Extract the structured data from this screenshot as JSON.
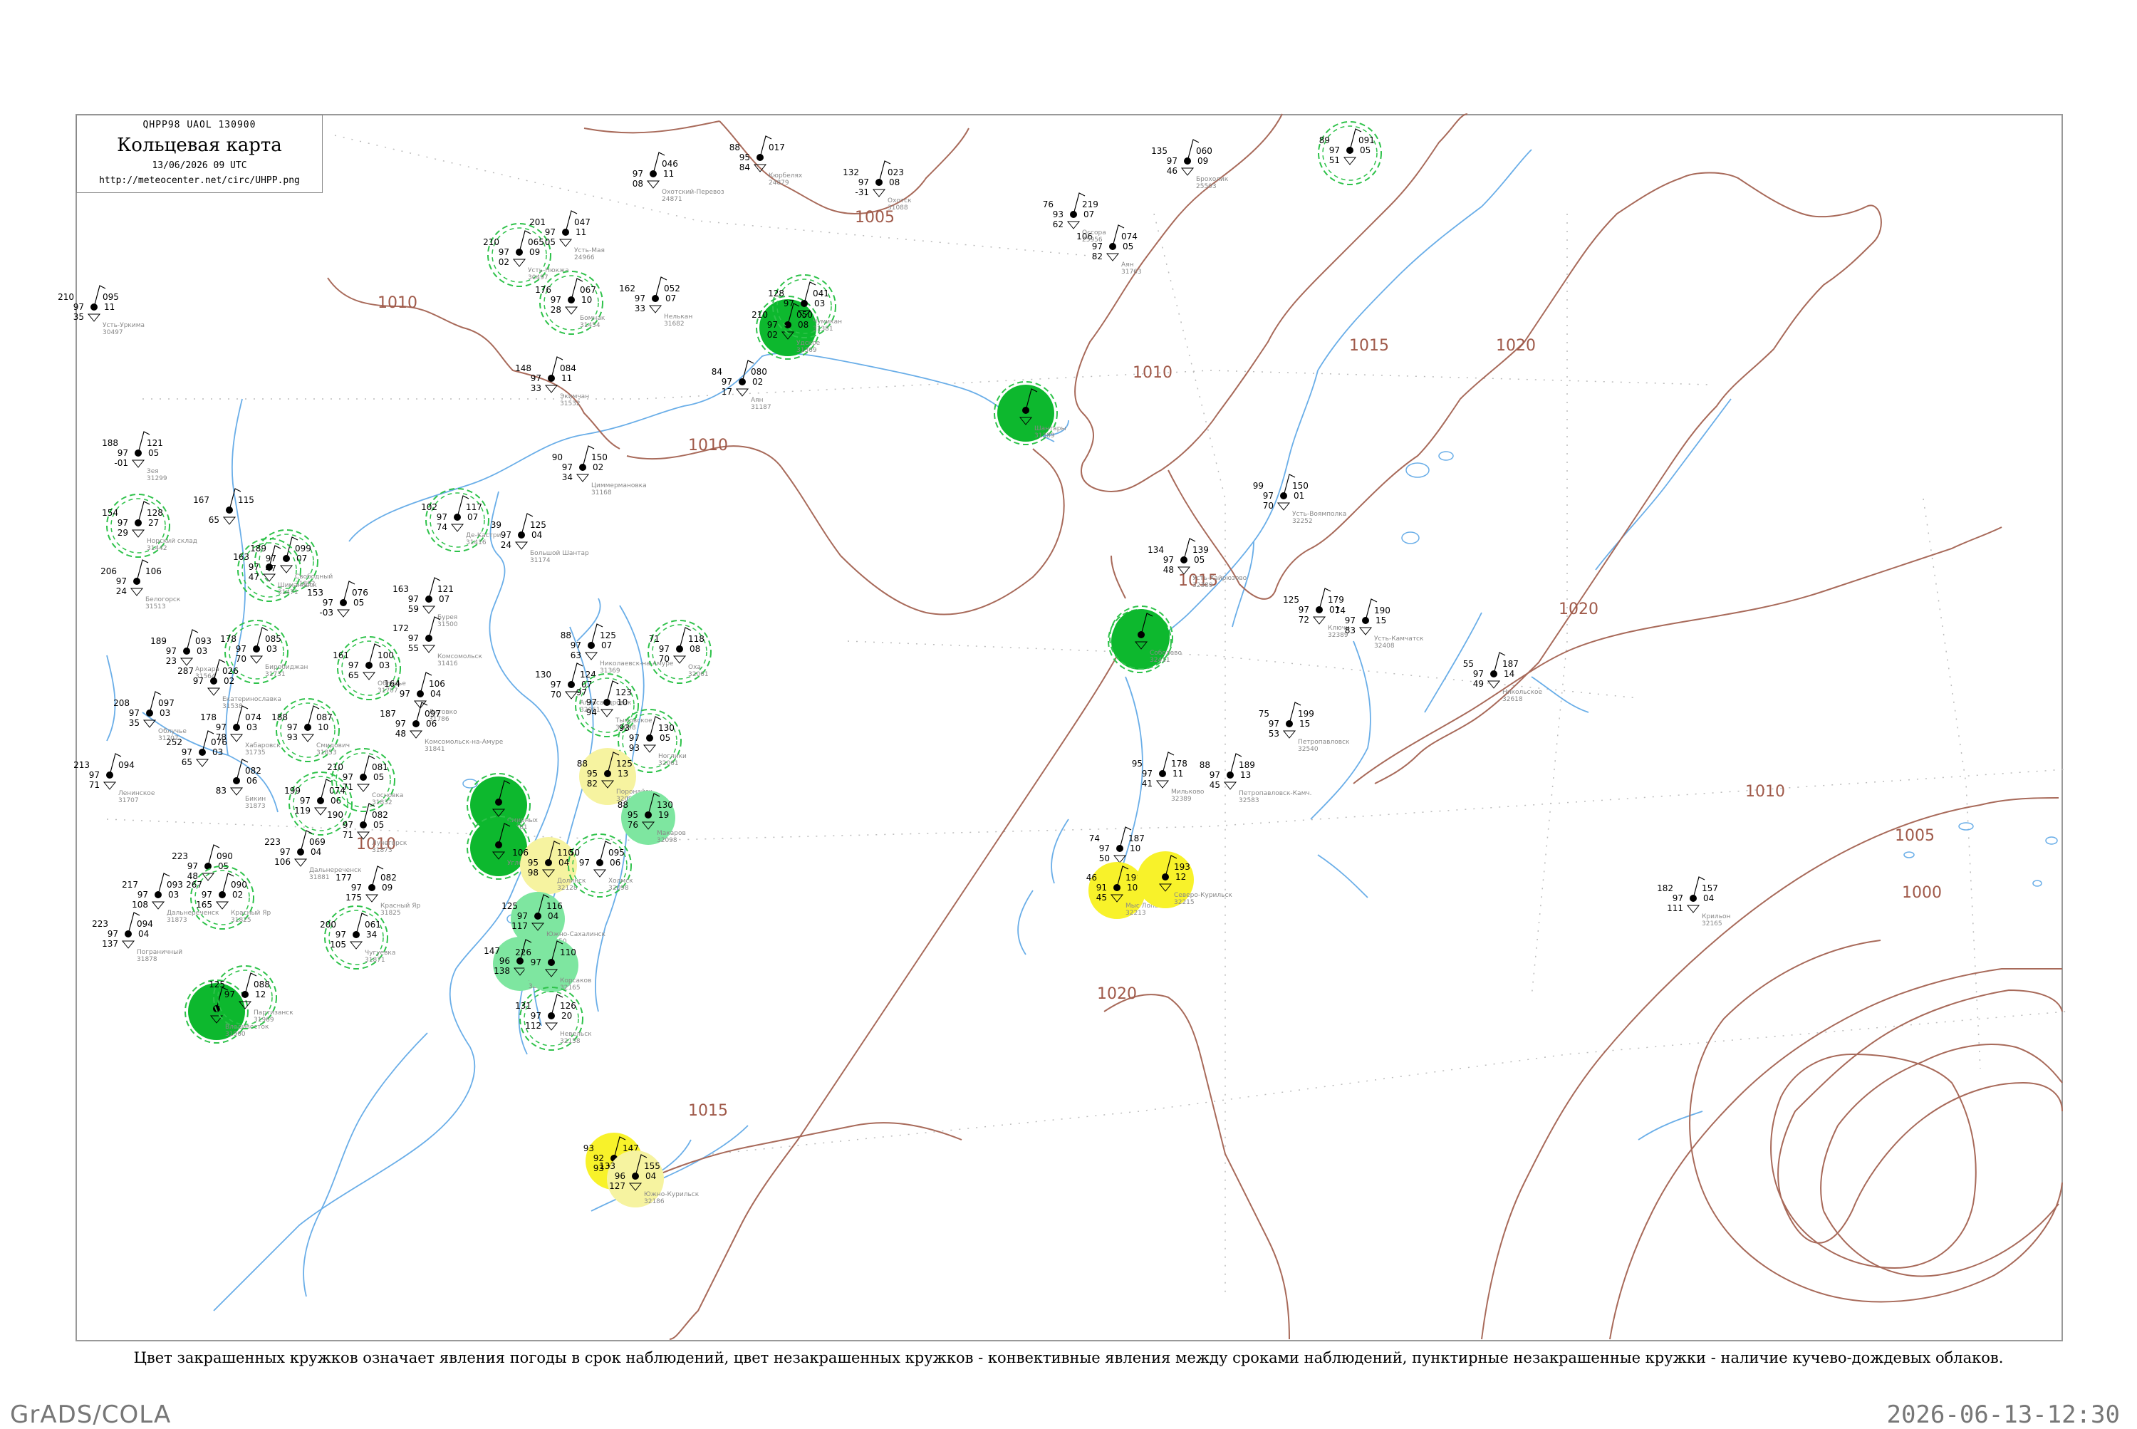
{
  "header": {
    "code": "QHPP98  UAOL  130900",
    "title": "Кольцевая карта",
    "datetime": "13/06/2026 09 UTC",
    "url": "http://meteocenter.net/circ/UHPP.png"
  },
  "footer": {
    "legend": "Цвет закрашенных кружков означает явления погоды в срок наблюдений, цвет незакрашенных кружков - конвективные явления между сроками наблюдений, пунктирные незакрашенные кружки - наличие кучево-дождевых облаков.",
    "software": "GrADS/COLA",
    "timestamp": "2026-06-13-12:30"
  },
  "colors": {
    "isobar": "#a86a5a",
    "water": "#6aaee8",
    "dark_green": "#0db82e",
    "light_green": "#7ee6a0",
    "yellow": "#f8f22a",
    "light_yellow": "#f6f3a0",
    "dashed_ring": "#2ec24a",
    "frame": "#999999"
  },
  "isobars": [
    {
      "label": "1010"
    },
    {
      "label": "1005"
    },
    {
      "label": "1010"
    },
    {
      "label": "1010"
    },
    {
      "label": "1015"
    },
    {
      "label": "1015"
    },
    {
      "label": "1020"
    },
    {
      "label": "1020"
    },
    {
      "label": "1010"
    },
    {
      "label": "1005"
    },
    {
      "label": "1000"
    },
    {
      "label": "1020"
    },
    {
      "label": "1015"
    },
    {
      "label": "1010"
    }
  ],
  "stations": [
    {
      "left": "210",
      "right": "095",
      "l2": "97",
      "r2": "11",
      "l3": "35",
      "name": "Усть-Уркима",
      "idx": "30497",
      "marker": "none"
    },
    {
      "left": "",
      "right": "046",
      "l2": "97",
      "r2": "11",
      "l3": "08",
      "name": "Охотский-Перевоз",
      "idx": "24871",
      "marker": "none"
    },
    {
      "left": "88",
      "right": "017",
      "l2": "95",
      "r2": "",
      "l3": "84",
      "name": "Кюрбелях",
      "idx": "24879",
      "marker": "none"
    },
    {
      "left": "132",
      "right": "023",
      "l2": "97",
      "r2": "08",
      "l3": "-31",
      "name": "Охотск",
      "idx": "31088",
      "marker": "none"
    },
    {
      "left": "135",
      "right": "060",
      "l2": "97",
      "r2": "09",
      "l3": "46",
      "name": "Брохолик",
      "idx": "25503",
      "marker": "none"
    },
    {
      "left": "89",
      "right": "091",
      "l2": "97",
      "r2": "05",
      "l3": "51",
      "name": "",
      "idx": "",
      "marker": "dashed"
    },
    {
      "left": "210",
      "right": "065",
      "l2": "97",
      "r2": "09",
      "l3": "02",
      "name": "Усть-Нюкжа",
      "idx": "30497",
      "marker": "dashed"
    },
    {
      "left": "201",
      "right": "047",
      "l2": "97",
      "r2": "11",
      "l3": "05",
      "name": "Усть-Мая",
      "idx": "24966",
      "marker": "none"
    },
    {
      "left": "106",
      "right": "074",
      "l2": "97",
      "r2": "05",
      "l3": "82",
      "name": "Аян",
      "idx": "31763",
      "marker": "none"
    },
    {
      "left": "176",
      "right": "067",
      "l2": "97",
      "r2": "10",
      "l3": "28",
      "name": "Бомнак",
      "idx": "31454",
      "marker": "dashed"
    },
    {
      "left": "162",
      "right": "052",
      "l2": "97",
      "r2": "07",
      "l3": "33",
      "name": "Нелькан",
      "idx": "31682",
      "marker": "none"
    },
    {
      "left": "210",
      "right": "050",
      "l2": "97",
      "r2": "08",
      "l3": "02",
      "name": "Удское",
      "idx": "31369",
      "marker": "dark"
    },
    {
      "left": "128",
      "right": "041",
      "l2": "97",
      "r2": "03",
      "l3": "",
      "name": "Чумикан",
      "idx": "31381",
      "marker": "dashed"
    },
    {
      "left": "148",
      "right": "084",
      "l2": "97",
      "r2": "11",
      "l3": "33",
      "name": "Экимчан",
      "idx": "31532",
      "marker": "none"
    },
    {
      "left": "84",
      "right": "080",
      "l2": "97",
      "r2": "02",
      "l3": "17",
      "name": "Аян",
      "idx": "31187",
      "marker": "none"
    },
    {
      "left": "",
      "right": "",
      "l2": "",
      "r2": "",
      "l3": "",
      "name": "Шантары",
      "idx": "31389",
      "marker": "dark"
    },
    {
      "left": "188",
      "right": "121",
      "l2": "97",
      "r2": "05",
      "l3": "-01",
      "name": "Зея",
      "idx": "31299",
      "marker": "none"
    },
    {
      "left": "90",
      "right": "150",
      "l2": "97",
      "r2": "02",
      "l3": "34",
      "name": "Циммермановка",
      "idx": "31168",
      "marker": "none"
    },
    {
      "left": "154",
      "right": "128",
      "l2": "97",
      "r2": "27",
      "l3": "29",
      "name": "Норский склад",
      "idx": "31442",
      "marker": "dashed"
    },
    {
      "left": "167",
      "right": "115",
      "l2": "",
      "r2": "",
      "l3": "65",
      "name": "",
      "idx": "",
      "marker": "none"
    },
    {
      "left": "102",
      "right": "117",
      "l2": "97",
      "r2": "07",
      "l3": "74",
      "name": "Де-Кастри",
      "idx": "31416",
      "marker": "dashed"
    },
    {
      "left": "99",
      "right": "150",
      "l2": "97",
      "r2": "01",
      "l3": "70",
      "name": "Усть-Воямполка",
      "idx": "32252",
      "marker": "none"
    },
    {
      "left": "189",
      "right": "099",
      "l2": "97",
      "r2": "07",
      "l3": "47",
      "name": "Свободный",
      "idx": "31892",
      "marker": "dashed"
    },
    {
      "left": "163",
      "right": "",
      "l2": "97",
      "r2": "",
      "l3": "47",
      "name": "Шимановск",
      "idx": "31471",
      "marker": "dashed"
    },
    {
      "left": "39",
      "right": "125",
      "l2": "97",
      "r2": "04",
      "l3": "24",
      "name": "Большой Шантар",
      "idx": "31174",
      "marker": "none"
    },
    {
      "left": "134",
      "right": "139",
      "l2": "97",
      "r2": "05",
      "l3": "48",
      "name": "Усть-Хайрюзово",
      "idx": "32389",
      "marker": "none"
    },
    {
      "left": "206",
      "right": "106",
      "l2": "97",
      "r2": "",
      "l3": "24",
      "name": "Белогорск",
      "idx": "31513",
      "marker": "none"
    },
    {
      "left": "153",
      "right": "076",
      "l2": "97",
      "r2": "05",
      "l3": "-03",
      "name": "",
      "idx": "",
      "marker": "none"
    },
    {
      "left": "163",
      "right": "121",
      "l2": "97",
      "r2": "07",
      "l3": "59",
      "name": "Бурея",
      "idx": "31500",
      "marker": "none"
    },
    {
      "left": "172",
      "right": "",
      "l2": "97",
      "r2": "",
      "l3": "55",
      "name": "Комсомольск",
      "idx": "31416",
      "marker": "none"
    },
    {
      "left": "125",
      "right": "179",
      "l2": "97",
      "r2": "01",
      "l3": "72",
      "name": "Ключи",
      "idx": "32389",
      "marker": "none"
    },
    {
      "left": "74",
      "right": "190",
      "l2": "97",
      "r2": "15",
      "l3": "83",
      "name": "Усть-Камчатск",
      "idx": "32408",
      "marker": "none"
    },
    {
      "left": "189",
      "right": "093",
      "l2": "97",
      "r2": "03",
      "l3": "23",
      "name": "Архара",
      "idx": "31564",
      "marker": "none"
    },
    {
      "left": "178",
      "right": "085",
      "l2": "97",
      "r2": "03",
      "l3": "70",
      "name": "Биробиджан",
      "idx": "31731",
      "marker": "dashed"
    },
    {
      "left": "",
      "right": "",
      "l2": "",
      "r2": "",
      "l3": "",
      "name": "",
      "idx": "",
      "marker": "dark"
    },
    {
      "left": "88",
      "right": "125",
      "l2": "97",
      "r2": "07",
      "l3": "63",
      "name": "Николаевск-на-Амуре",
      "idx": "31369",
      "marker": "none"
    },
    {
      "left": "71",
      "right": "118",
      "l2": "97",
      "r2": "08",
      "l3": "70",
      "name": "Оха",
      "idx": "32061",
      "marker": "dashed"
    },
    {
      "left": "55",
      "right": "187",
      "l2": "97",
      "r2": "14",
      "l3": "49",
      "name": "Никольское",
      "idx": "32618",
      "marker": "none"
    },
    {
      "left": "161",
      "right": "100",
      "l2": "97",
      "r2": "03",
      "l3": "65",
      "name": "Облучье",
      "idx": "31707",
      "marker": "dashed"
    },
    {
      "left": "287",
      "right": "026",
      "l2": "97",
      "r2": "02",
      "l3": "",
      "name": "Екатеринославка",
      "idx": "31538",
      "marker": "none"
    },
    {
      "left": "164",
      "right": "106",
      "l2": "97",
      "r2": "04",
      "l3": "",
      "name": "Литовко",
      "idx": "31786",
      "marker": "none"
    },
    {
      "left": "130",
      "right": "124",
      "l2": "97",
      "r2": "07",
      "l3": "70",
      "name": "Александровск",
      "idx": "32061",
      "marker": "none"
    },
    {
      "left": "208",
      "right": "097",
      "l2": "97",
      "r2": "03",
      "l3": "35",
      "name": "Облучье",
      "idx": "31707",
      "marker": "none"
    },
    {
      "left": "178",
      "right": "074",
      "l2": "97",
      "r2": "03",
      "l3": "78",
      "name": "Хабаровск",
      "idx": "31735",
      "marker": "none"
    },
    {
      "left": "188",
      "right": "087",
      "l2": "97",
      "r2": "10",
      "l3": "93",
      "name": "Смидович",
      "idx": "31853",
      "marker": "dashed"
    },
    {
      "left": "187",
      "right": "097",
      "l2": "97",
      "r2": "06",
      "l3": "48",
      "name": "Комсомольск-на-Амуре",
      "idx": "31841",
      "marker": "none"
    },
    {
      "left": "97",
      "right": "123",
      "l2": "97",
      "r2": "10",
      "l3": "94",
      "name": "Тымовское",
      "idx": "32098",
      "marker": "dashed"
    },
    {
      "left": "93",
      "right": "130",
      "l2": "97",
      "r2": "05",
      "l3": "93",
      "name": "Ноглики",
      "idx": "32061",
      "marker": "dashed"
    },
    {
      "left": "75",
      "right": "199",
      "l2": "97",
      "r2": "15",
      "l3": "53",
      "name": "Петропавловск",
      "idx": "32540",
      "marker": "none"
    },
    {
      "left": "213",
      "right": "094",
      "l2": "97",
      "r2": "",
      "l3": "71",
      "name": "Ленинское",
      "idx": "31707",
      "marker": "none"
    },
    {
      "left": "252",
      "right": "076",
      "l2": "97",
      "r2": "03",
      "l3": "65",
      "name": "",
      "idx": "",
      "marker": "none"
    },
    {
      "left": "",
      "right": "082",
      "l2": "",
      "r2": "06",
      "l3": "83",
      "name": "Бикин",
      "idx": "31873",
      "marker": "none"
    },
    {
      "left": "88",
      "right": "125",
      "l2": "95",
      "r2": "13",
      "l3": "82",
      "name": "Поронайск",
      "idx": "32098",
      "marker": "lightyellow"
    },
    {
      "left": "95",
      "right": "178",
      "l2": "97",
      "r2": "11",
      "l3": "41",
      "name": "Мильково",
      "idx": "32389",
      "marker": "none"
    },
    {
      "left": "88",
      "right": "189",
      "l2": "97",
      "r2": "13",
      "l3": "45",
      "name": "Петропавловск-Камч.",
      "idx": "32583",
      "marker": "none"
    },
    {
      "left": "",
      "right": "",
      "l2": "",
      "r2": "",
      "l3": "",
      "name": "Смирных",
      "idx": "32061",
      "marker": "dark"
    },
    {
      "left": "88",
      "right": "130",
      "l2": "95",
      "r2": "19",
      "l3": "76",
      "name": "Макаров",
      "idx": "32098",
      "marker": "lightgreen"
    },
    {
      "left": "199",
      "right": "074",
      "l2": "97",
      "r2": "06",
      "l3": "119",
      "name": "",
      "idx": "",
      "marker": "dashed"
    },
    {
      "left": "210",
      "right": "081",
      "l2": "97",
      "r2": "05",
      "l3": "71",
      "name": "Сосновка",
      "idx": "31832",
      "marker": "dashed"
    },
    {
      "left": "190",
      "right": "082",
      "l2": "97",
      "r2": "05",
      "l3": "71",
      "name": "Лучегорск",
      "idx": "31873",
      "marker": "none"
    },
    {
      "left": "",
      "right": "",
      "l2": "",
      "r2": "",
      "l3": "",
      "name": "Углегорск",
      "idx": "",
      "marker": "dark"
    },
    {
      "left": "106",
      "right": "110",
      "l2": "95",
      "r2": "04",
      "l3": "98",
      "name": "Долинск",
      "idx": "32128",
      "marker": "lightyellow"
    },
    {
      "left": "50",
      "right": "095",
      "l2": "97",
      "r2": "06",
      "l3": "",
      "name": "Холмск",
      "idx": "32098",
      "marker": "dashed"
    },
    {
      "left": "74",
      "right": "187",
      "l2": "97",
      "r2": "10",
      "l3": "50",
      "name": "",
      "idx": "",
      "marker": "none"
    },
    {
      "left": "223",
      "right": "069",
      "l2": "97",
      "r2": "04",
      "l3": "106",
      "name": "Дальнереченск",
      "idx": "31881",
      "marker": "none"
    },
    {
      "left": "223",
      "right": "090",
      "l2": "97",
      "r2": "05",
      "l3": "48",
      "name": "",
      "idx": "",
      "marker": "none"
    },
    {
      "left": "46",
      "right": "198",
      "l2": "91",
      "r2": "10",
      "l3": "45",
      "name": "Мыс Лопатка",
      "idx": "32213",
      "marker": "yellow"
    },
    {
      "left": "",
      "right": "193",
      "l2": "",
      "r2": "12",
      "l3": "",
      "name": "Северо-Курильск",
      "idx": "32215",
      "marker": "yellow"
    },
    {
      "left": "177",
      "right": "082",
      "l2": "97",
      "r2": "09",
      "l3": "175",
      "name": "Красный Яр",
      "idx": "31825",
      "marker": "none"
    },
    {
      "left": "217",
      "right": "093",
      "l2": "97",
      "r2": "03",
      "l3": "108",
      "name": "Дальнереченск",
      "idx": "31873",
      "marker": "none"
    },
    {
      "left": "267",
      "right": "090",
      "l2": "97",
      "r2": "02",
      "l3": "165",
      "name": "Красный Яр",
      "idx": "31825",
      "marker": "dashed"
    },
    {
      "left": "125",
      "right": "116",
      "l2": "97",
      "r2": "04",
      "l3": "117",
      "name": "Южно-Сахалинск",
      "idx": "32150",
      "marker": "lightgreen"
    },
    {
      "left": "182",
      "right": "157",
      "l2": "97",
      "r2": "04",
      "l3": "111",
      "name": "Крильон",
      "idx": "32165",
      "marker": "none"
    },
    {
      "left": "223",
      "right": "094",
      "l2": "97",
      "r2": "04",
      "l3": "137",
      "name": "Пограничный",
      "idx": "31878",
      "marker": "none"
    },
    {
      "left": "200",
      "right": "061",
      "l2": "97",
      "r2": "34",
      "l3": "105",
      "name": "Чугуевка",
      "idx": "31871",
      "marker": "dashed"
    },
    {
      "left": "147",
      "right": "",
      "l2": "96",
      "r2": "",
      "l3": "138",
      "name": "Анива",
      "idx": "32150",
      "marker": "lightgreen"
    },
    {
      "left": "226",
      "right": "110",
      "l2": "97",
      "r2": "",
      "l3": "",
      "name": "Корсаков",
      "idx": "32165",
      "marker": "lightgreen"
    },
    {
      "left": "",
      "right": "",
      "l2": "",
      "r2": "",
      "l3": "",
      "name": "Владивосток",
      "idx": "31960",
      "marker": "dark"
    },
    {
      "left": "125",
      "right": "088",
      "l2": "97",
      "r2": "12",
      "l3": "",
      "name": "Партизанск",
      "idx": "31969",
      "marker": "dashed"
    },
    {
      "left": "131",
      "right": "126",
      "l2": "97",
      "r2": "20",
      "l3": "112",
      "name": "Невельск",
      "idx": "32158",
      "marker": "dashed"
    },
    {
      "left": "93",
      "right": "147",
      "l2": "92",
      "r2": "",
      "l3": "93",
      "name": "",
      "idx": "",
      "marker": "yellow"
    },
    {
      "left": "133",
      "right": "155",
      "l2": "96",
      "r2": "04",
      "l3": "127",
      "name": "Южно-Курильск",
      "idx": "32186",
      "marker": "lightyellow"
    },
    {
      "left": "76",
      "right": "219",
      "l2": "93",
      "r2": "07",
      "l3": "62",
      "name": "Оссора",
      "idx": "25956",
      "marker": "none"
    },
    {
      "left": "",
      "right": "",
      "l2": "",
      "r2": "",
      "l3": "",
      "name": "Соболево",
      "idx": "32411",
      "marker": "dark"
    }
  ]
}
